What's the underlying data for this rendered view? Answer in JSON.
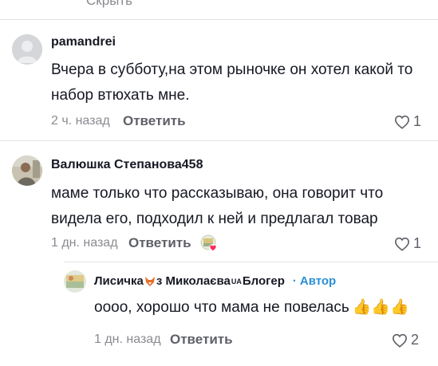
{
  "top_link": {
    "label": "Скрыть",
    "caret": "⌃"
  },
  "comments": [
    {
      "username": "pamandrei",
      "text_line1": "Вчера в субботу,на этом рыночке он хотел какой то",
      "text_line2": "набор втюхать мне.",
      "time": "2 ч. назад",
      "reply_label": "Ответить",
      "likes": "1"
    },
    {
      "username": "Валюшка Степанова458",
      "text_line1": "маме только что рассказываю, она говорит что",
      "text_line2": "видела его, подходил к ней и предлагал товар",
      "time": "1 дн. назад",
      "reply_label": "Ответить",
      "likes": "1"
    }
  ],
  "reply": {
    "username_part1": "Лисичка",
    "username_part2": "з Миколаєва",
    "username_tag": "UA",
    "username_part3": "Блогер",
    "author_label": "Автор",
    "text": "оооо, хорошо что мама не повелась",
    "emoji": "👍👍👍",
    "time": "1 дн. назад",
    "reply_label": "Ответить",
    "likes": "2"
  },
  "colors": {
    "primary_text": "#161823",
    "secondary_text": "#8a8b91",
    "author_blue": "#2b8fd6",
    "heart_badge": "#fe2c55"
  }
}
